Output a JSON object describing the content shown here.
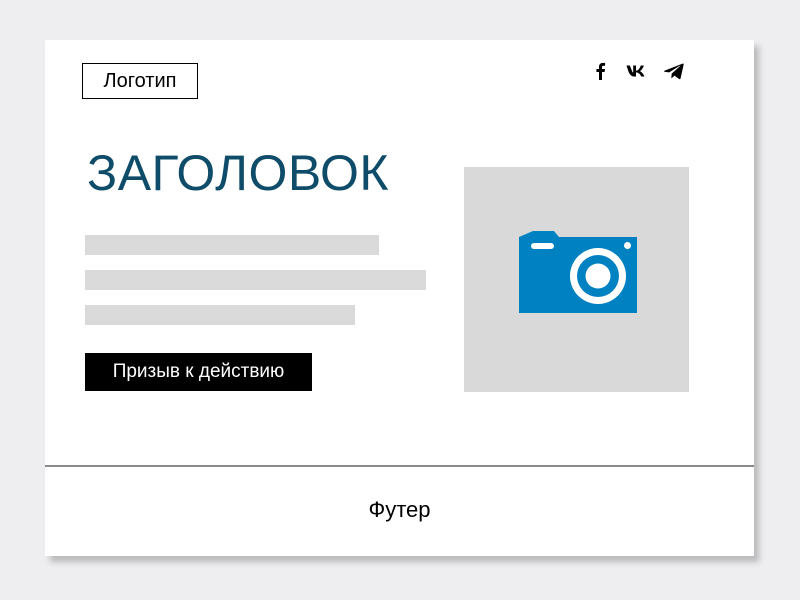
{
  "header": {
    "logo_label": "Логотип",
    "social_icons": [
      "facebook-icon",
      "vk-icon",
      "telegram-icon"
    ]
  },
  "hero": {
    "title": "ЗАГОЛОВОК",
    "cta_label": "Призыв к действию",
    "image_icon": "camera-icon"
  },
  "footer": {
    "label": "Футер"
  },
  "colors": {
    "background": "#eeeef0",
    "card": "#ffffff",
    "title": "#0e4c6a",
    "placeholder": "#dadada",
    "image_bg": "#d9d9d9",
    "camera": "#0081c1",
    "cta_bg": "#000000",
    "cta_text": "#ffffff"
  }
}
